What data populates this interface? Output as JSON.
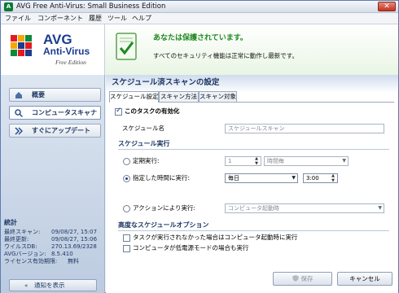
{
  "window": {
    "title": "AVG Free Anti-Virus: Small Business Edition"
  },
  "menu": [
    "ファイル",
    "コンポーネント",
    "履歴",
    "ツール",
    "ヘルプ"
  ],
  "logo": {
    "brand": "AVG",
    "product": "Anti-Virus",
    "edition": "Free Edition"
  },
  "status": {
    "title": "あなたは保護されています。",
    "description": "すべてのセキュリティ機能は正常に動作し最新です。"
  },
  "nav": {
    "items": [
      {
        "label": "概要"
      },
      {
        "label": "コンピュータスキャナ"
      },
      {
        "label": "すぐにアップデート"
      }
    ]
  },
  "stats": {
    "title": "統計",
    "rows": [
      {
        "key": "最終スキャン:",
        "value": "09/08/27, 15:07"
      },
      {
        "key": "最終更新:",
        "value": "09/08/27, 15:06"
      },
      {
        "key": "ウイルスDB:",
        "value": "270.13.69/2328"
      },
      {
        "key": "AVGバージョン:",
        "value": "8.5.410"
      },
      {
        "key": "ライセンス有効期限:",
        "value": "無料"
      }
    ]
  },
  "notify": {
    "arrows": "«",
    "label": "通知を表示"
  },
  "panel": {
    "title": "スケジュール済スキャンの設定",
    "tabs": [
      "スケジュール設定",
      "スキャン方法",
      "スキャン対象"
    ],
    "enable_task_label": "このタスクの有効化",
    "schedule_name_label": "スケジュール名",
    "schedule_name_value": "スケジュールスキャン",
    "run_section": "スケジュール実行",
    "periodic_label": "定期実行:",
    "periodic_value": "1",
    "periodic_unit": "時間毎",
    "specific_label": "指定した時間に実行:",
    "specific_value": "毎日",
    "specific_time": "3:00",
    "action_label": "アクションにより実行:",
    "action_value": "コンピュータ起動時",
    "advanced_section": "高度なスケジュールオプション",
    "opt_missed": "タスクが実行されなかった場合はコンピュータ起動時に実行",
    "opt_lowpower": "コンピュータが低電源モードの場合も実行",
    "save_label": "保存",
    "cancel_label": "キャンセル"
  },
  "colors": {
    "brand_blue": "#1a3d8f",
    "status_green": "#1e8a1e",
    "nav_text": "#1f3864"
  }
}
